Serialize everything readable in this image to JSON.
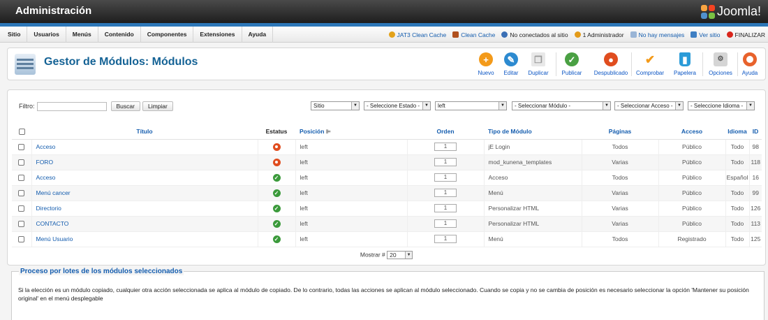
{
  "app": {
    "title": "Administración",
    "brand": "Joomla!"
  },
  "menu": [
    "Sitio",
    "Usuarios",
    "Menús",
    "Contenido",
    "Componentes",
    "Extensiones",
    "Ayuda"
  ],
  "status": {
    "jat3": "JAT3 Clean Cache",
    "clean_cache": "Clean Cache",
    "no_connected": "No conectados al sitio",
    "admins": "1 Administrador",
    "messages": "No hay mensajes",
    "view_site": "Ver sitio",
    "logout": "FINALIZAR"
  },
  "toolbar": {
    "title": "Gestor de Módulos: Módulos",
    "buttons": {
      "new": "Nuevo",
      "edit": "Editar",
      "duplicate": "Duplicar",
      "publish": "Publicar",
      "unpublish": "Despublicado",
      "checkin": "Comprobar",
      "trash": "Papelera",
      "options": "Opciones",
      "help": "Ayuda"
    }
  },
  "filter": {
    "label": "Filtro:",
    "search_value": "",
    "search_btn": "Buscar",
    "clear_btn": "Limpiar",
    "site": "Sitio",
    "state": "- Seleccione Estado -",
    "position": "left",
    "module": "- Seleccionar Módulo -",
    "access": "- Seleccionar Acceso -",
    "language": "- Seleccione Idioma -"
  },
  "table": {
    "headers": {
      "title": "Título",
      "status": "Estatus",
      "position": "Posición",
      "order": "Orden",
      "type": "Tipo de Módulo",
      "pages": "Páginas",
      "access": "Acceso",
      "language": "Idioma",
      "id": "ID"
    },
    "rows": [
      {
        "title": "Acceso",
        "published": false,
        "position": "left",
        "order": "1",
        "type": "jE Login",
        "pages": "Todos",
        "access": "Público",
        "language": "Todo",
        "id": "98"
      },
      {
        "title": "FORO",
        "published": false,
        "position": "left",
        "order": "1",
        "type": "mod_kunena_templates",
        "pages": "Varias",
        "access": "Público",
        "language": "Todo",
        "id": "118"
      },
      {
        "title": "Acceso",
        "published": true,
        "position": "left",
        "order": "1",
        "type": "Acceso",
        "pages": "Todos",
        "access": "Público",
        "language": "Español",
        "id": "16"
      },
      {
        "title": "Menú cancer",
        "published": true,
        "position": "left",
        "order": "1",
        "type": "Menú",
        "pages": "Varias",
        "access": "Público",
        "language": "Todo",
        "id": "99"
      },
      {
        "title": "Directorio",
        "published": true,
        "position": "left",
        "order": "1",
        "type": "Personalizar HTML",
        "pages": "Varias",
        "access": "Público",
        "language": "Todo",
        "id": "126"
      },
      {
        "title": "CONTACTO",
        "published": true,
        "position": "left",
        "order": "1",
        "type": "Personalizar HTML",
        "pages": "Varias",
        "access": "Público",
        "language": "Todo",
        "id": "113"
      },
      {
        "title": "Menú Usuario",
        "published": true,
        "position": "left",
        "order": "1",
        "type": "Menú",
        "pages": "Todos",
        "access": "Registrado",
        "language": "Todo",
        "id": "125"
      }
    ]
  },
  "pager": {
    "label": "Mostrar #",
    "value": "20"
  },
  "batch": {
    "legend": "Proceso por lotes de los módulos seleccionados",
    "description": "Si la elección es un módulo copiado, cualquier otra acción seleccionada se aplica al módulo de copiado. De lo contrario, todas las acciones se aplican al módulo seleccionado. Cuando se copia y no se cambia de posición es necesario seleccionar la opción 'Mantener su posición original' en el menú desplegable"
  },
  "colors": {
    "link": "#135cae",
    "accent_blue": "#2c77b8",
    "published": "#3b9a3b",
    "unpublished": "#e04d1f"
  }
}
